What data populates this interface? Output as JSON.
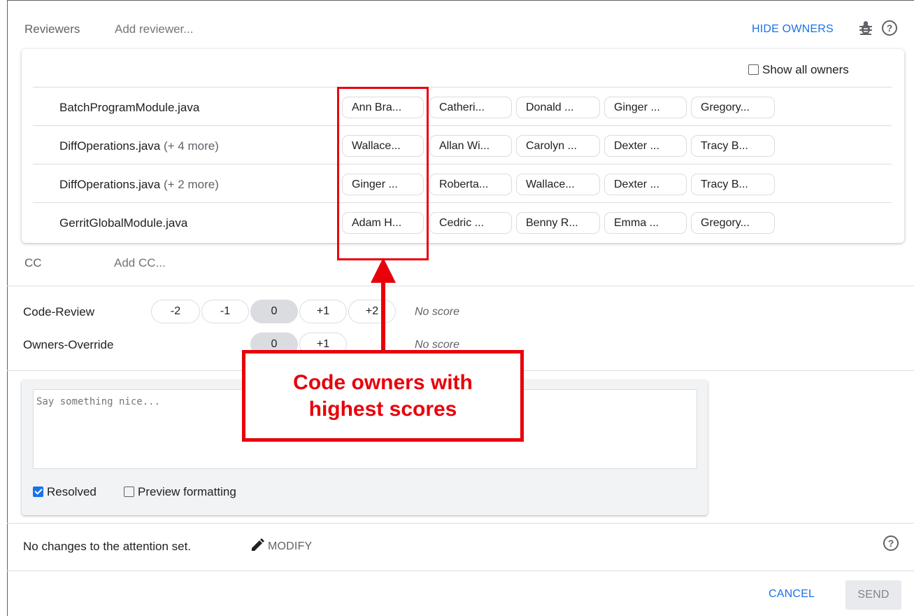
{
  "header": {
    "reviewers_label": "Reviewers",
    "add_reviewer_placeholder": "Add reviewer...",
    "hide_owners_label": "HIDE OWNERS"
  },
  "owners": {
    "show_all_label": "Show all owners",
    "show_all_checked": false,
    "rows": [
      {
        "file": "BatchProgramModule.java",
        "more": "",
        "chips": [
          "Ann Bra...",
          "Catheri...",
          "Donald ...",
          "Ginger ...",
          "Gregory..."
        ]
      },
      {
        "file": "DiffOperations.java",
        "more": "(+ 4 more)",
        "chips": [
          "Wallace...",
          "Allan Wi...",
          "Carolyn ...",
          "Dexter ...",
          "Tracy B..."
        ]
      },
      {
        "file": "DiffOperations.java",
        "more": "(+ 2 more)",
        "chips": [
          "Ginger ...",
          "Roberta...",
          "Wallace...",
          "Dexter ...",
          "Tracy B..."
        ]
      },
      {
        "file": "GerritGlobalModule.java",
        "more": "",
        "chips": [
          "Adam H...",
          "Cedric ...",
          "Benny R...",
          "Emma ...",
          "Gregory..."
        ]
      }
    ]
  },
  "cc": {
    "label": "CC",
    "placeholder": "Add CC..."
  },
  "labels": {
    "code_review": {
      "name": "Code-Review",
      "values": [
        "-2",
        "-1",
        "0",
        "+1",
        "+2"
      ],
      "selected": "0",
      "status": "No score"
    },
    "owners_override": {
      "name": "Owners-Override",
      "values": [
        "0",
        "+1"
      ],
      "selected": "0",
      "status": "No score"
    }
  },
  "comment": {
    "placeholder": "Say something nice...",
    "resolved_label": "Resolved",
    "resolved_checked": true,
    "preview_label": "Preview formatting",
    "preview_checked": false
  },
  "attention": {
    "text": "No changes to the attention set.",
    "modify_label": "MODIFY"
  },
  "actions": {
    "cancel_label": "CANCEL",
    "send_label": "SEND"
  },
  "annotation": {
    "line1": "Code owners with",
    "line2": "highest scores"
  },
  "colors": {
    "accent": "#1a73e8",
    "annotation": "#e8000b"
  }
}
